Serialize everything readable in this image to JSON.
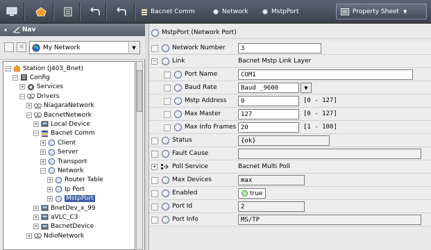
{
  "toolbar": {
    "breadcrumbs": [
      "Bacnet Comm",
      "Network",
      "MstpPort"
    ],
    "view_selector": "Property Sheet"
  },
  "nav": {
    "title": "Nav",
    "selector_value": "My Network",
    "tree": [
      {
        "label": "Station (J403_Bnet)",
        "depth": 0,
        "expander": "-",
        "icon": "station-icon"
      },
      {
        "label": "Config",
        "depth": 1,
        "expander": "-",
        "icon": "config-icon"
      },
      {
        "label": "Services",
        "depth": 2,
        "expander": "+",
        "icon": "services-icon"
      },
      {
        "label": "Drivers",
        "depth": 2,
        "expander": "-",
        "icon": "drivers-icon"
      },
      {
        "label": "NiagaraNetwork",
        "depth": 3,
        "expander": "+",
        "icon": "network-icon"
      },
      {
        "label": "BacnetNetwork",
        "depth": 3,
        "expander": "-",
        "icon": "network-icon"
      },
      {
        "label": "Local Device",
        "depth": 4,
        "expander": "+",
        "icon": "device-icon"
      },
      {
        "label": "Bacnet Comm",
        "depth": 4,
        "expander": "-",
        "icon": "comm-icon"
      },
      {
        "label": "Client",
        "depth": 5,
        "expander": "+",
        "icon": "circle-icon"
      },
      {
        "label": "Server",
        "depth": 5,
        "expander": "+",
        "icon": "circle-icon"
      },
      {
        "label": "Transport",
        "depth": 5,
        "expander": "+",
        "icon": "circle-icon"
      },
      {
        "label": "Network",
        "depth": 5,
        "expander": "-",
        "icon": "circle-icon"
      },
      {
        "label": "Router Table",
        "depth": 6,
        "expander": "+",
        "icon": "circle-icon"
      },
      {
        "label": "Ip Port",
        "depth": 6,
        "expander": "+",
        "icon": "circle-icon"
      },
      {
        "label": "MstpPort",
        "depth": 6,
        "expander": "+",
        "icon": "circle-icon",
        "selected": true
      },
      {
        "label": "BnetDev_x_99",
        "depth": 4,
        "expander": "+",
        "icon": "device-icon"
      },
      {
        "label": "aVLC_C3",
        "depth": 4,
        "expander": "+",
        "icon": "device-icon"
      },
      {
        "label": "BacnetDevice",
        "depth": 4,
        "expander": "+",
        "icon": "device-icon"
      },
      {
        "label": "NdioNetwork",
        "depth": 3,
        "expander": "+",
        "icon": "network-icon"
      }
    ]
  },
  "sheet": {
    "header": "MstpPort  (Network Port)",
    "rows": [
      {
        "name": "Network Number",
        "indent": 0,
        "value": "3",
        "kind": "input",
        "width": 120
      },
      {
        "name": "Link",
        "indent": 0,
        "value": "Bacnet Mstp Link Layer",
        "kind": "plain",
        "expander": "-"
      },
      {
        "name": "Port Name",
        "indent": 1,
        "value": "COM1",
        "kind": "input",
        "width": 252
      },
      {
        "name": "Baud Rate",
        "indent": 1,
        "value": "Baud _9600",
        "kind": "select",
        "width": 88
      },
      {
        "name": "Mstp Address",
        "indent": 1,
        "value": "0",
        "kind": "input",
        "width": 88,
        "range": "[0 - 127]"
      },
      {
        "name": "Max Master",
        "indent": 1,
        "value": "127",
        "kind": "input",
        "width": 88,
        "range": "[0 - 127]"
      },
      {
        "name": "Max Info Frames",
        "indent": 1,
        "value": "20",
        "kind": "input",
        "width": 88,
        "range": "[1 - 100]"
      },
      {
        "name": "Status",
        "indent": 0,
        "value": "{ok}",
        "kind": "readonly",
        "width": 132
      },
      {
        "name": "Fault Cause",
        "indent": 0,
        "value": "",
        "kind": "readonly",
        "width": 264
      },
      {
        "name": "Poll Service",
        "indent": 0,
        "value": "Bacnet Multi Poll",
        "kind": "plain",
        "expander": "+",
        "icon": "poll-icon"
      },
      {
        "name": "Max Devices",
        "indent": 0,
        "value": "max",
        "kind": "readonly",
        "width": 96
      },
      {
        "name": "Enabled",
        "indent": 0,
        "value": "true",
        "kind": "bool"
      },
      {
        "name": "Port Id",
        "indent": 0,
        "value": "2",
        "kind": "readonly",
        "width": 96
      },
      {
        "name": "Port Info",
        "indent": 0,
        "value": "MS/TP",
        "kind": "readonly",
        "width": 264
      }
    ]
  }
}
